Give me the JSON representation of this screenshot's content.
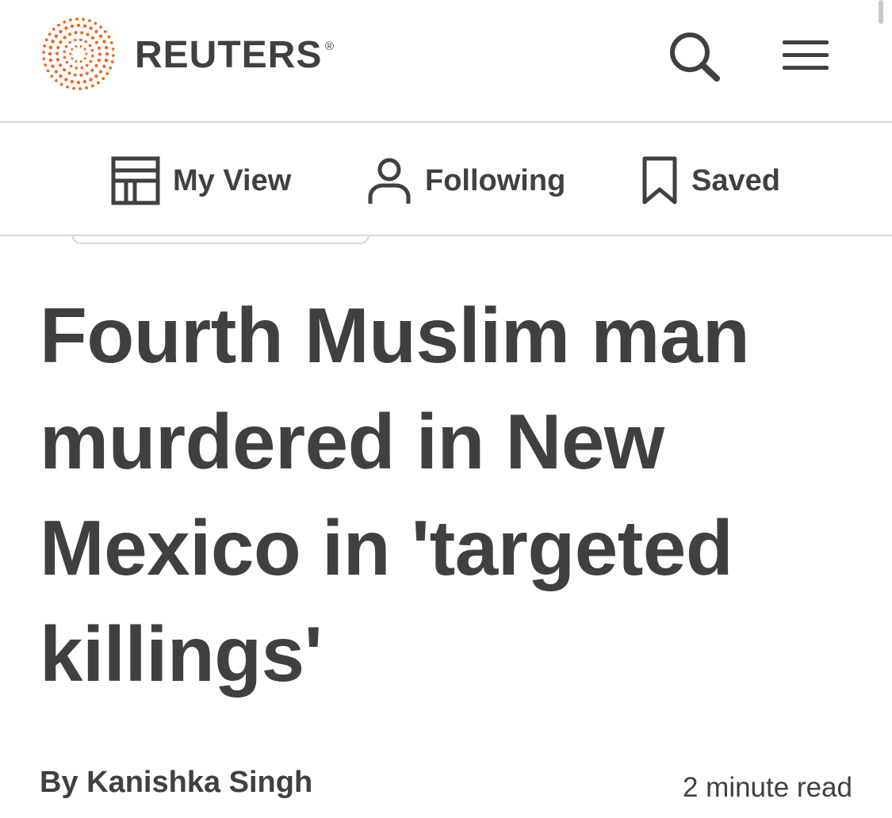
{
  "header": {
    "brand_name": "REUTERS",
    "brand_registered": "®",
    "accent_color": "#f26522",
    "search_icon": "search-icon",
    "menu_icon": "hamburger-menu-icon"
  },
  "subnav": {
    "items": [
      {
        "label": "My View",
        "icon": "layout-grid-icon"
      },
      {
        "label": "Following",
        "icon": "person-icon"
      },
      {
        "label": "Saved",
        "icon": "bookmark-icon"
      }
    ]
  },
  "article": {
    "headline": "Fourth Muslim man murdered in New Mexico in 'targeted killings'",
    "byline_prefix": "By",
    "author": "Kanishka Singh",
    "read_time": "2 minute read"
  }
}
